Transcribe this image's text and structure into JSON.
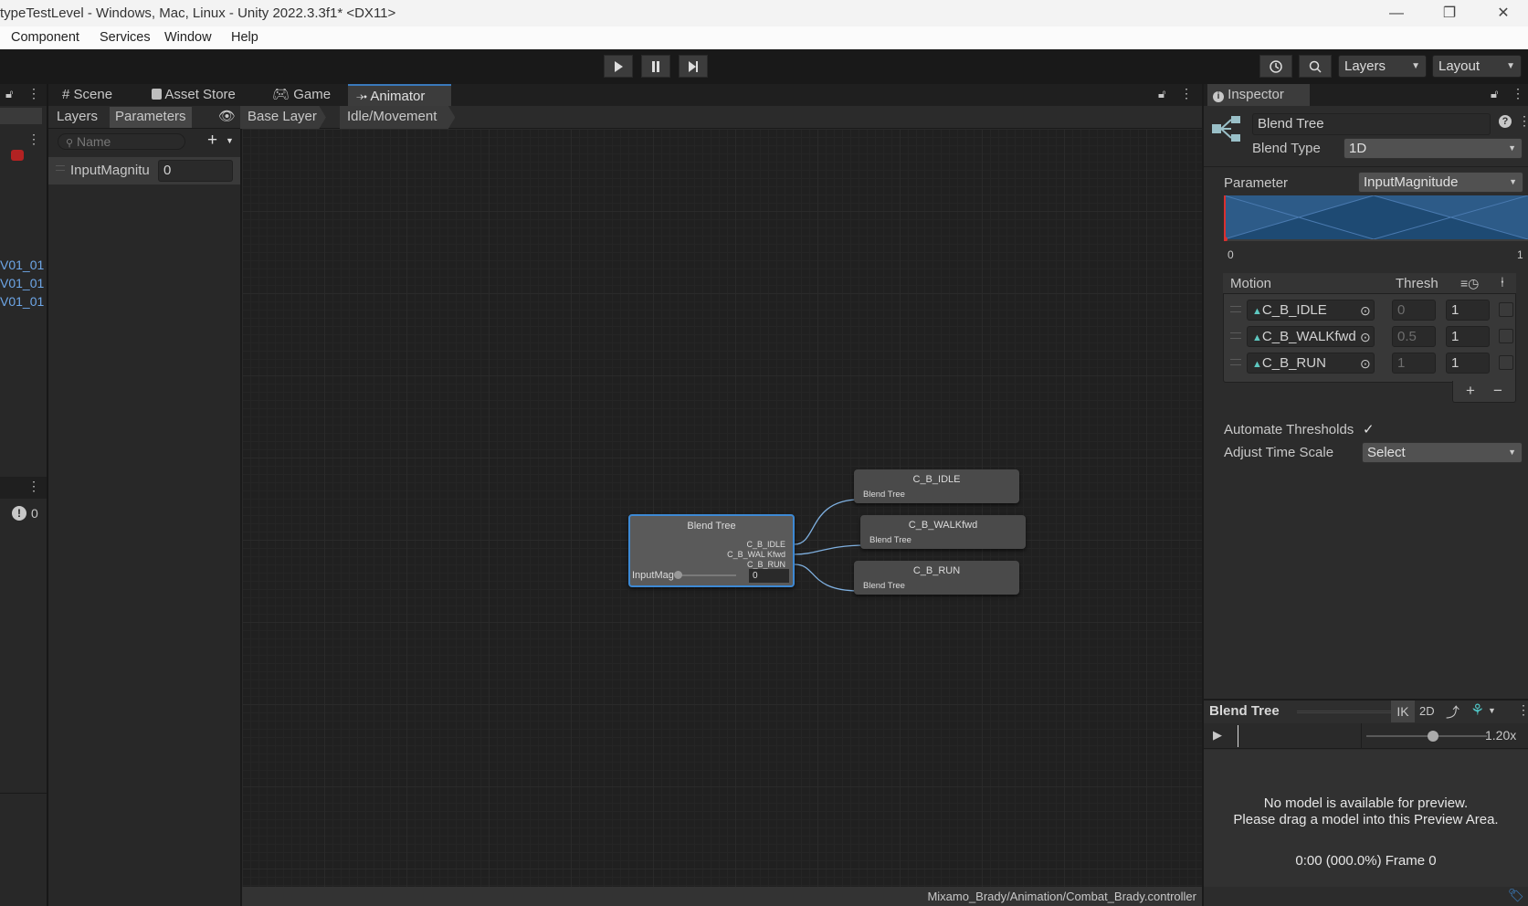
{
  "window": {
    "title": "typeTestLevel - Windows, Mac, Linux - Unity 2022.3.3f1* <DX11>",
    "minimize": "—",
    "restore": "❐",
    "close": "✕"
  },
  "menu": [
    "Component",
    "Services",
    "Window",
    "Help"
  ],
  "toolbar": {
    "play_icon": "play-icon",
    "pause_icon": "pause-icon",
    "step_icon": "step-icon",
    "layers_label": "Layers",
    "layout_label": "Layout"
  },
  "left_panel": {
    "items": [
      "V01_01",
      "V01_01",
      "V01_01"
    ],
    "console_count": "0"
  },
  "tabs": [
    {
      "label": "Scene",
      "icon": "grid-icon"
    },
    {
      "label": "Asset Store",
      "icon": "bag-icon"
    },
    {
      "label": "Game",
      "icon": "gamepad-icon"
    },
    {
      "label": "Animator",
      "icon": "animator-icon",
      "active": true
    }
  ],
  "animator": {
    "subtabs": [
      "Layers",
      "Parameters"
    ],
    "breadcrumb": [
      "Base Layer",
      "Idle/Movement"
    ],
    "search_placeholder": "Name",
    "parameter": {
      "name": "InputMagnitu",
      "value": "0"
    },
    "status_path": "Mixamo_Brady/Animation/Combat_Brady.controller",
    "graph": {
      "blend_node": {
        "title": "Blend Tree",
        "outputs": [
          "C_B_IDLE",
          "C_B_WAL Kfwd",
          "C_B_RUN"
        ],
        "param_label": "InputMag",
        "param_value": "0"
      },
      "clips": [
        {
          "title": "C_B_IDLE",
          "sub": "Blend Tree"
        },
        {
          "title": "C_B_WALKfwd",
          "sub": "Blend Tree"
        },
        {
          "title": "C_B_RUN",
          "sub": "Blend Tree"
        }
      ]
    }
  },
  "inspector": {
    "tab_label": "Inspector",
    "name": "Blend Tree",
    "blend_type_label": "Blend Type",
    "blend_type_value": "1D",
    "parameter_label": "Parameter",
    "parameter_value": "InputMagnitude",
    "range_min": "0",
    "range_max": "1",
    "motion_header": "Motion",
    "thresh_header": "Thresh",
    "motions": [
      {
        "name": "C_B_IDLE",
        "threshold": "0",
        "speed": "1"
      },
      {
        "name": "C_B_WALKfwd",
        "threshold": "0.5",
        "speed": "1"
      },
      {
        "name": "C_B_RUN",
        "threshold": "1",
        "speed": "1"
      }
    ],
    "add": "+",
    "remove": "−",
    "automate_label": "Automate Thresholds",
    "automate_checked": true,
    "adjust_label": "Adjust Time Scale",
    "adjust_value": "Select",
    "preview": {
      "title": "Blend Tree",
      "ik": "IK",
      "two_d": "2D",
      "speed": "1.20x",
      "speed_fraction": 0.55,
      "msg1": "No model is available for preview.",
      "msg2": "Please drag a model into this Preview Area.",
      "frame": "0:00 (000.0%) Frame 0"
    }
  },
  "colors": {
    "accent": "#3a79bb",
    "link": "#6ea7e8",
    "node_selected": "#3d89d4"
  }
}
